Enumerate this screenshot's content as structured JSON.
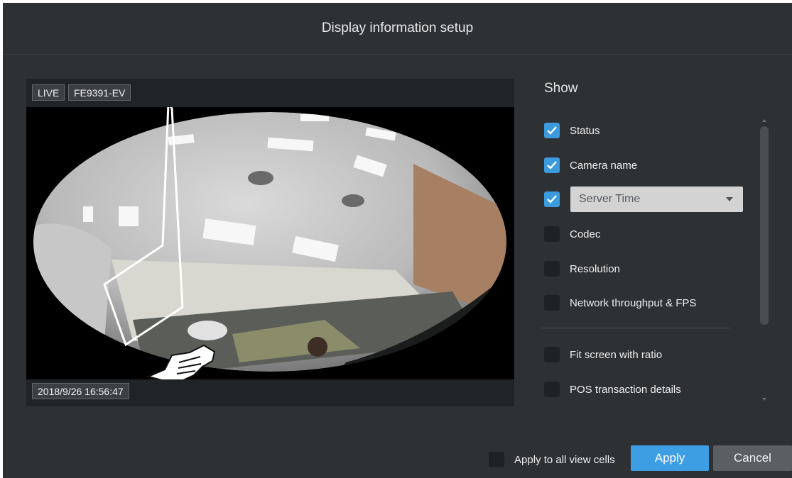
{
  "dialog": {
    "title": "Display information setup"
  },
  "preview": {
    "status_tag": "LIVE",
    "camera_tag": "FE9391-EV",
    "time_tag": "2018/9/26 16:56:47"
  },
  "show": {
    "title": "Show",
    "options": [
      {
        "label": "Status",
        "checked": true
      },
      {
        "label": "Camera name",
        "checked": true
      },
      {
        "label": "",
        "checked": true
      },
      {
        "label": "Codec",
        "checked": false
      },
      {
        "label": "Resolution",
        "checked": false
      },
      {
        "label": "Network throughput & FPS",
        "checked": false
      },
      {
        "label": "Fit screen with ratio",
        "checked": false
      },
      {
        "label": "POS transaction details",
        "checked": false
      }
    ],
    "time_select_value": "Server Time"
  },
  "footer": {
    "apply_all_label": "Apply to all view cells",
    "apply_label": "Apply",
    "cancel_label": "Cancel"
  },
  "colors": {
    "accent": "#3c9ade",
    "dialog_bg": "#2e3134"
  },
  "icons": [
    "checkmark-icon",
    "caret-down-icon",
    "arrow-annotation-icon",
    "hand-pointer-icon"
  ]
}
